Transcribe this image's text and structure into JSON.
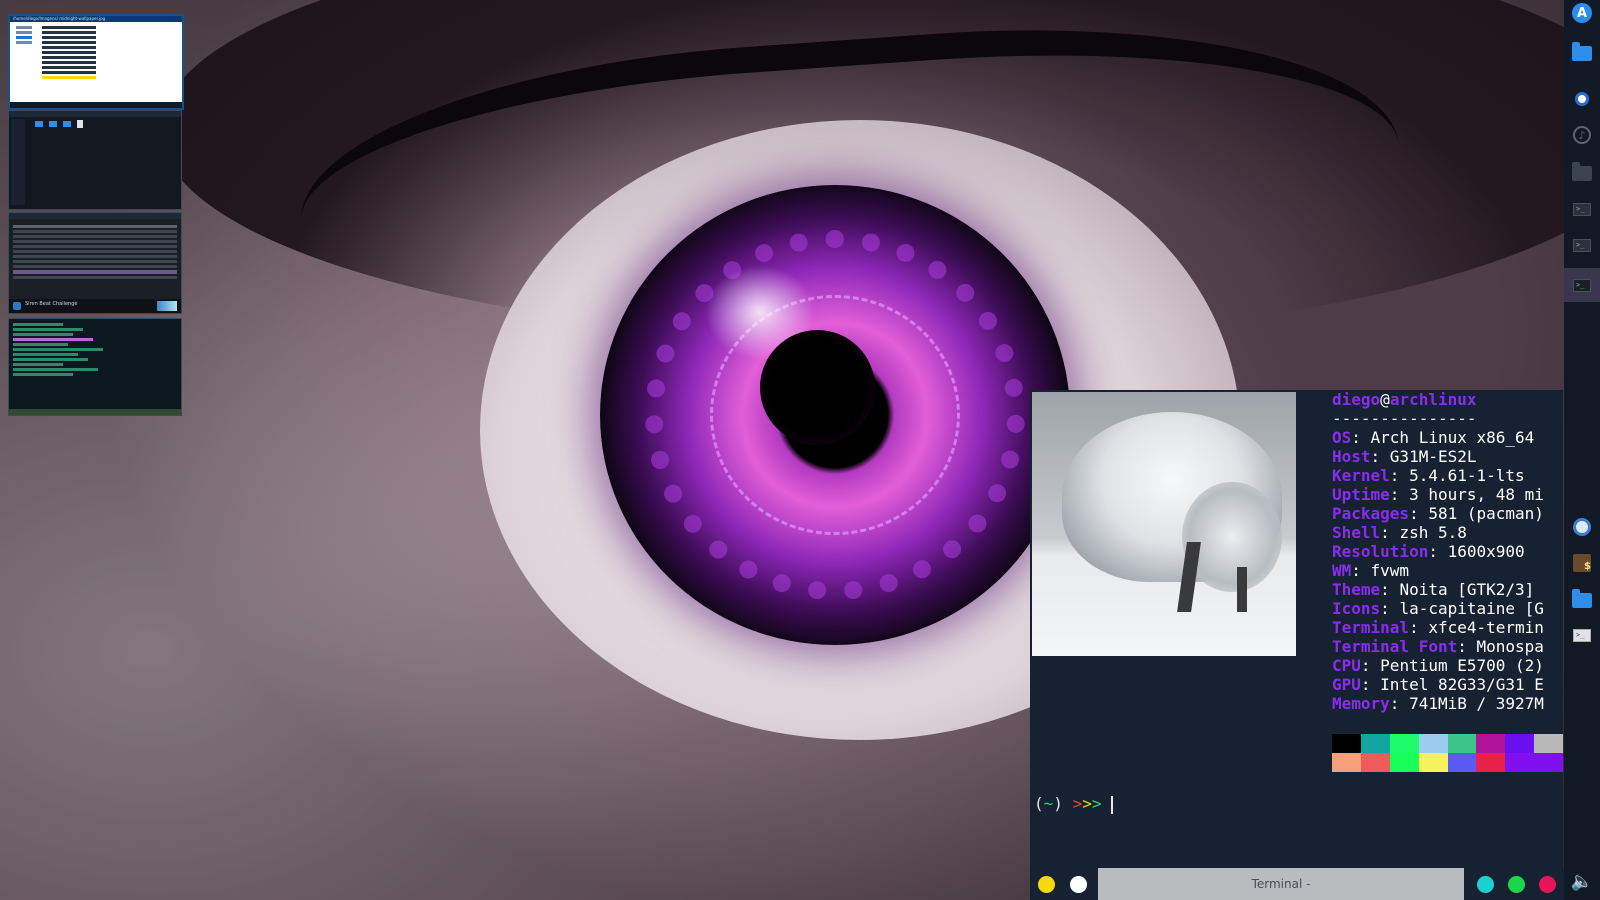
{
  "neofetch": {
    "user": "diego",
    "at": "@",
    "host": "archlinux",
    "separator": "---------------",
    "rows": [
      {
        "key": "OS",
        "value": ": Arch Linux x86_64"
      },
      {
        "key": "Host",
        "value": ": G31M-ES2L"
      },
      {
        "key": "Kernel",
        "value": ": 5.4.61-1-lts"
      },
      {
        "key": "Uptime",
        "value": ": 3 hours, 48 mi"
      },
      {
        "key": "Packages",
        "value": ": 581 (pacman)"
      },
      {
        "key": "Shell",
        "value": ": zsh 5.8"
      },
      {
        "key": "Resolution",
        "value": ": 1600x900"
      },
      {
        "key": "WM",
        "value": ": fvwm"
      },
      {
        "key": "Theme",
        "value": ": Noita [GTK2/3]"
      },
      {
        "key": "Icons",
        "value": ": la-capitaine [G"
      },
      {
        "key": "Terminal",
        "value": ": xfce4-termin"
      },
      {
        "key": "Terminal Font",
        "value": ": Monospa"
      },
      {
        "key": "CPU",
        "value": ": Pentium E5700 (2)"
      },
      {
        "key": "GPU",
        "value": ": Intel 82G33/G31 E"
      },
      {
        "key": "Memory",
        "value": ": 741MiB / 3927M"
      }
    ],
    "palette_top": [
      "#000000",
      "#12a5a0",
      "#1dfa6a",
      "#9ccbf0",
      "#3cc48a",
      "#b0139a",
      "#6a10f0",
      "#b8b8b8"
    ],
    "palette_bottom": [
      "#f4a07a",
      "#f05a5a",
      "#18ff5a",
      "#f4f45a",
      "#5a5af4",
      "#e8204a",
      "#8010f0",
      "#8010f0"
    ]
  },
  "prompt": {
    "open": "(",
    "tilde": "~",
    "close": ")",
    "arrow1": ">",
    "arrow2": ">",
    "arrow3": ">"
  },
  "taskbar": {
    "task_label": "Terminal -",
    "left_dots": [
      "#f5d90a",
      "#ffffff"
    ],
    "right_dots": [
      "#1ad1d1",
      "#1bd64a",
      "#e8145a"
    ]
  },
  "thumbnails": {
    "file_manager_path": "/home/diego/Imagens/  midnight-wallpaper.jpg",
    "music_now_playing": "Siren Beat Challenge"
  },
  "dock": {
    "icons": [
      "arch-launcher-icon",
      "folder-icon",
      "chromium-icon",
      "music-player-icon",
      "folder-icon",
      "terminal-icon",
      "terminal-icon",
      "terminal-icon-active",
      "browser-icon",
      "package-icon",
      "folder-icon",
      "terminal-icon",
      "volume-icon"
    ]
  }
}
